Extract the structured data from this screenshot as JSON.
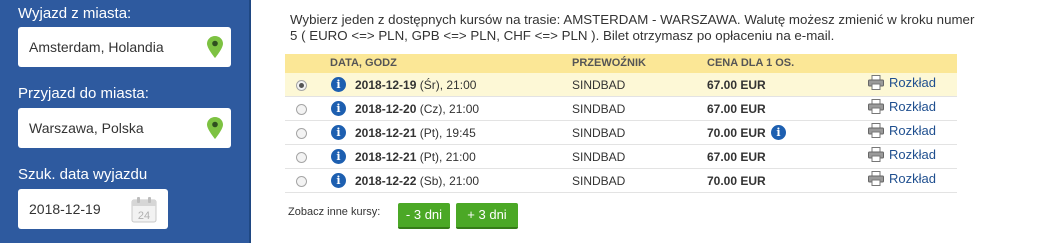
{
  "search": {
    "from_label": "Wyjazd z miasta:",
    "from_value": "Amsterdam, Holandia",
    "to_label": "Przyjazd do miasta:",
    "to_value": "Warszawa, Polska",
    "date_label": "Szuk. data wyjazdu",
    "date_value": "2018-12-19",
    "calendar_day": "24"
  },
  "intro_text": "Wybierz jeden z dostępnych kursów na trasie: AMSTERDAM - WARSZAWA. Walutę możesz zmienić w kroku numer 5 ( EURO <=> PLN, GPB <=> PLN, CHF <=> PLN ). Bilet otrzymasz po opłaceniu na e-mail.",
  "table": {
    "headers": {
      "date": "DATA, GODZ",
      "carrier": "PRZEWOŹNIK",
      "price": "CENA DLA 1 OS."
    },
    "rows": [
      {
        "date": "2018-12-19",
        "rest": " (Śr), 21:00",
        "carrier": "SINDBAD",
        "price": "67.00 EUR",
        "schedule": "Rozkład"
      },
      {
        "date": "2018-12-20",
        "rest": " (Cz), 21:00",
        "carrier": "SINDBAD",
        "price": "67.00 EUR",
        "schedule": "Rozkład"
      },
      {
        "date": "2018-12-21",
        "rest": " (Pt), 19:45",
        "carrier": "SINDBAD",
        "price": "70.00 EUR",
        "schedule": "Rozkład"
      },
      {
        "date": "2018-12-21",
        "rest": " (Pt), 21:00",
        "carrier": "SINDBAD",
        "price": "67.00 EUR",
        "schedule": "Rozkład"
      },
      {
        "date": "2018-12-22",
        "rest": " (Sb), 21:00",
        "carrier": "SINDBAD",
        "price": "70.00 EUR",
        "schedule": "Rozkład"
      }
    ]
  },
  "more_courses": {
    "label": "Zobacz inne kursy:",
    "minus": "- 3 dni",
    "plus": "+ 3 dni"
  },
  "colors": {
    "sidebar": "#2e5a9f",
    "header_row": "#fbe796",
    "button": "#4ba826",
    "info_icon": "#1d5fb0",
    "pin": "#7dc242"
  }
}
